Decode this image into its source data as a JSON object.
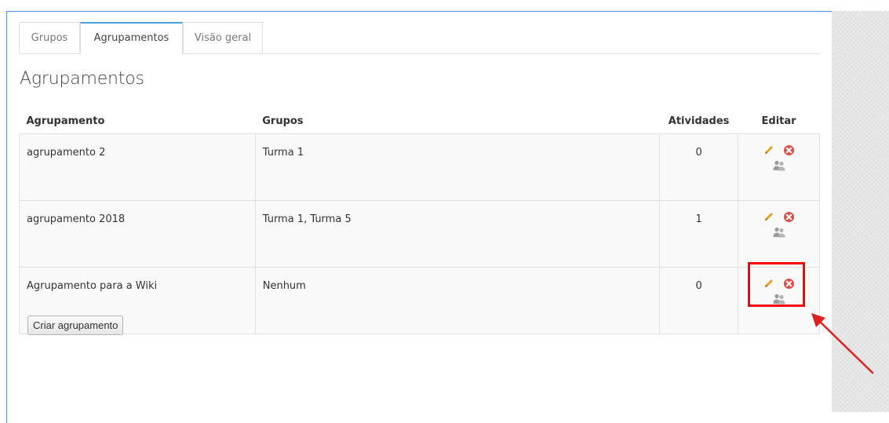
{
  "tabs": [
    {
      "label": "Grupos",
      "active": false
    },
    {
      "label": "Agrupamentos",
      "active": true
    },
    {
      "label": "Visão geral",
      "active": false
    }
  ],
  "page_title": "Agrupamentos",
  "table": {
    "headers": {
      "agrupamento": "Agrupamento",
      "grupos": "Grupos",
      "atividades": "Atividades",
      "editar": "Editar"
    },
    "rows": [
      {
        "name": "agrupamento 2",
        "groups": "Turma 1",
        "activities": "0"
      },
      {
        "name": "agrupamento 2018",
        "groups": "Turma 1, Turma 5",
        "activities": "1"
      },
      {
        "name": "Agrupamento para a Wiki",
        "groups": "Nenhum",
        "activities": "0"
      }
    ],
    "action_icons": [
      "edit-pencil-icon",
      "delete-icon",
      "groups-icon"
    ]
  },
  "create_button": "Criar agrupamento",
  "colors": {
    "active_tab_accent": "#4aa3df",
    "pencil": "#e8a020",
    "delete": "#d9534f",
    "highlight": "#ff0000",
    "frame_border": "#5a8fd6"
  }
}
